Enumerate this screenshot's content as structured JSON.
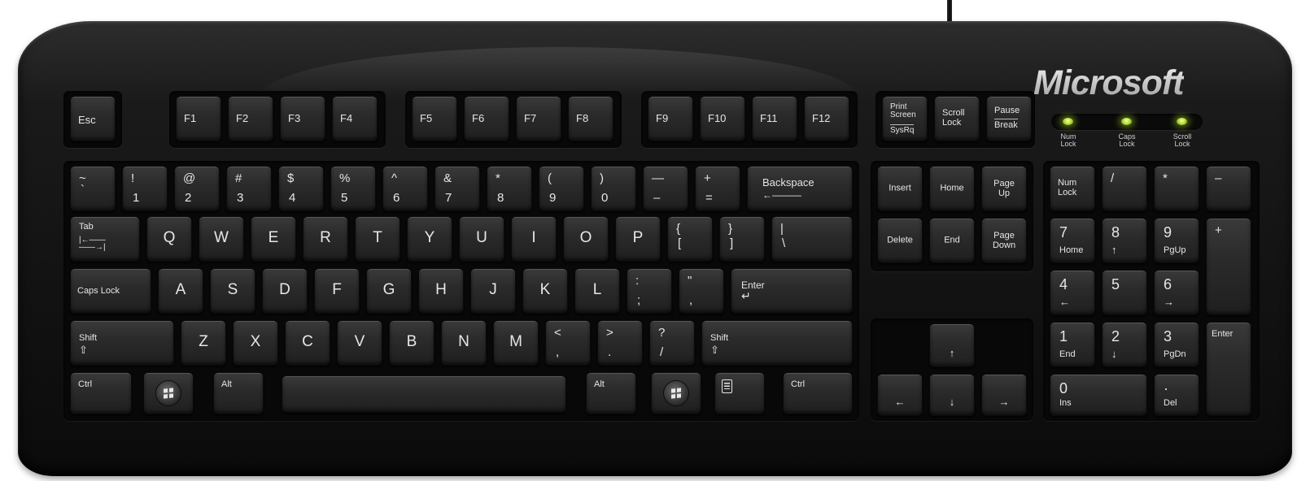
{
  "brand": {
    "logo": "Microsoft"
  },
  "indicators": [
    {
      "id": "num",
      "label": "Num\nLock",
      "on": true
    },
    {
      "id": "caps",
      "label": "Caps\nLock",
      "on": true
    },
    {
      "id": "scroll",
      "label": "Scroll\nLock",
      "on": true
    }
  ],
  "keys": {
    "esc": "Esc",
    "f1": "F1",
    "f2": "F2",
    "f3": "F3",
    "f4": "F4",
    "f5": "F5",
    "f6": "F6",
    "f7": "F7",
    "f8": "F8",
    "f9": "F9",
    "f10": "F10",
    "f11": "F11",
    "f12": "F12",
    "print": "Print\nScreen",
    "sysrq": "SysRq",
    "scroll": "Scroll\nLock",
    "pause": "Pause",
    "break": "Break",
    "tilde_top": "~",
    "tilde_bottom": "`",
    "n1_top": "!",
    "n1_bottom": "1",
    "n2_top": "@",
    "n2_bottom": "2",
    "n3_top": "#",
    "n3_bottom": "3",
    "n4_top": "$",
    "n4_bottom": "4",
    "n5_top": "%",
    "n5_bottom": "5",
    "n6_top": "^",
    "n6_bottom": "6",
    "n7_top": "&",
    "n7_bottom": "7",
    "n8_top": "*",
    "n8_bottom": "8",
    "n9_top": "(",
    "n9_bottom": "9",
    "n0_top": ")",
    "n0_bottom": "0",
    "minus_top": "—",
    "minus_bottom": "–",
    "equal_top": "+",
    "equal_bottom": "=",
    "backspace": "Backspace",
    "tab": "Tab",
    "q": "Q",
    "w": "W",
    "e": "E",
    "r": "R",
    "t": "T",
    "y": "Y",
    "u": "U",
    "i": "I",
    "o": "O",
    "p": "P",
    "lbracket_top": "{",
    "lbracket_bottom": "[",
    "rbracket_top": "}",
    "rbracket_bottom": "]",
    "backslash_top": "|",
    "backslash_bottom": "\\",
    "capslock": "Caps Lock",
    "a": "A",
    "s": "S",
    "d": "D",
    "f": "F",
    "g": "G",
    "h": "H",
    "j": "J",
    "k": "K",
    "l": "L",
    "semicolon_top": ":",
    "semicolon_bottom": ";",
    "quote_top": "\"",
    "quote_bottom": ",",
    "enter": "Enter",
    "shift": "Shift",
    "z": "Z",
    "x": "X",
    "c": "C",
    "v": "V",
    "b": "B",
    "n": "N",
    "m": "M",
    "comma_top": "<",
    "comma_bottom": ",",
    "period_top": ">",
    "period_bottom": ".",
    "slash_top": "?",
    "slash_bottom": "/",
    "ctrl": "Ctrl",
    "alt": "Alt",
    "insert": "Insert",
    "home": "Home",
    "pageup": "Page\nUp",
    "delete": "Delete",
    "end": "End",
    "pagedown": "Page\nDown",
    "numlock": "Num\nLock",
    "np_slash": "/",
    "np_star": "*",
    "np_minus": "–",
    "np7": "7",
    "np7_sub": "Home",
    "np8": "8",
    "np9": "9",
    "np9_sub": "PgUp",
    "np_plus": "+",
    "np4": "4",
    "np5": "5",
    "np6": "6",
    "np1": "1",
    "np1_sub": "End",
    "np2": "2",
    "np3": "3",
    "np3_sub": "PgDn",
    "np_enter": "Enter",
    "np0": "0",
    "np0_sub": "Ins",
    "np_dot": "·",
    "np_dot_sub": "Del"
  },
  "glyphs": {
    "arrow_up": "↑",
    "arrow_down": "↓",
    "arrow_left": "←",
    "arrow_right": "→",
    "shift_icon": "⇧",
    "enter_icon": "↵",
    "backspace_arrow": "←———",
    "tab_arrows": "|←——\n——→|"
  },
  "colors": {
    "body": "#151515",
    "key": "#2b2b2b",
    "legend": "#e6e6e6",
    "led": "#b8e23a"
  }
}
